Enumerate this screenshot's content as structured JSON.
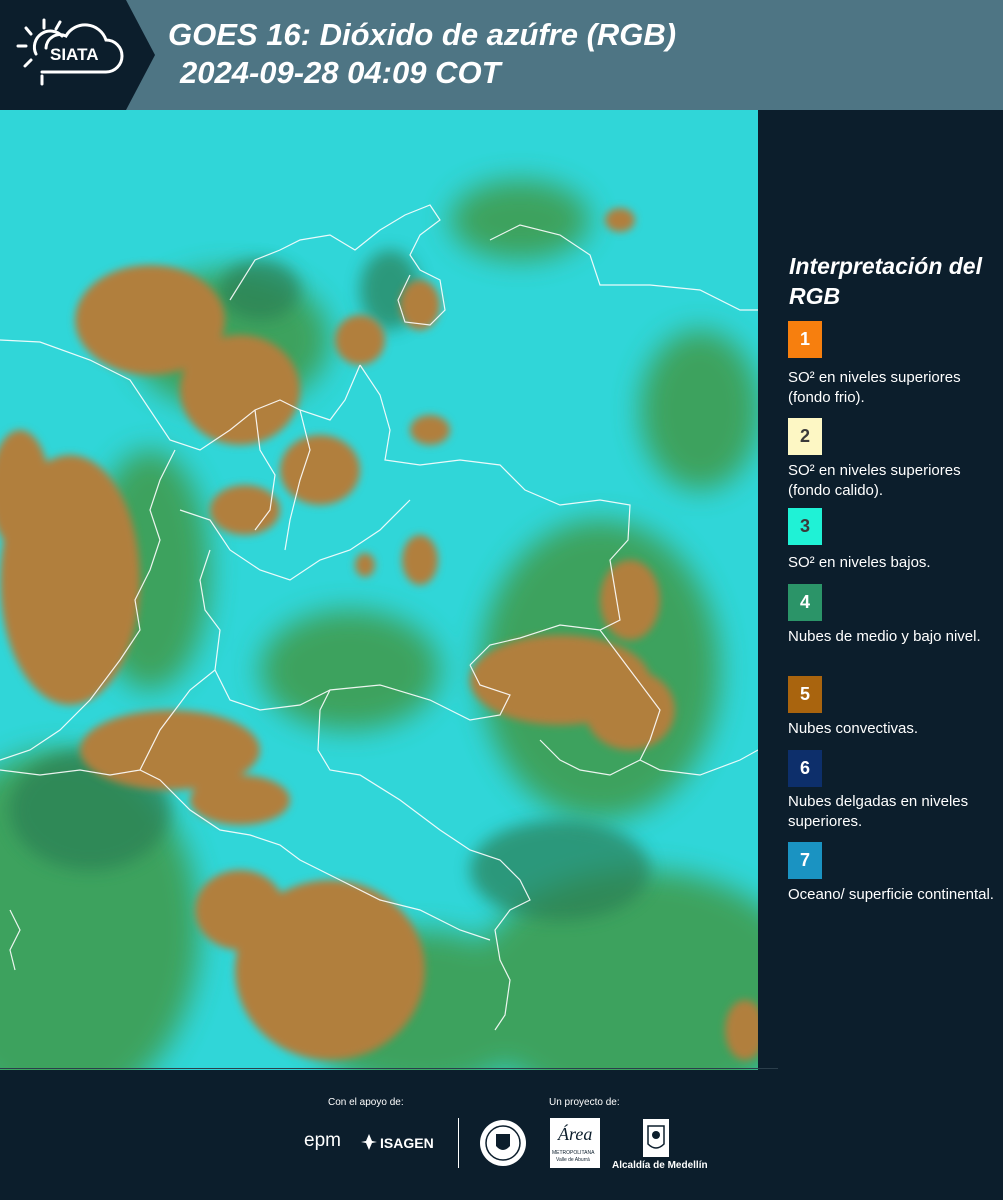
{
  "header": {
    "logo_text": "SIATA",
    "title_line1": "GOES 16: Dióxido de azúfre (RGB)",
    "title_line2": "2024-09-28 04:09 COT"
  },
  "map": {
    "background_color": "#2fd7d9"
  },
  "legend": {
    "title": "Interpretación del RGB",
    "items": [
      {
        "num": "1",
        "color": "#f77f0e",
        "text": "SO² en niveles superiores (fondo frio)."
      },
      {
        "num": "2",
        "color": "#fdf7c4",
        "text": "SO² en niveles superiores (fondo calido)."
      },
      {
        "num": "3",
        "color": "#1ff2d6",
        "text": "SO² en niveles bajos."
      },
      {
        "num": "4",
        "color": "#2b9468",
        "text": "Nubes de medio y bajo nivel."
      },
      {
        "num": "5",
        "color": "#a9640e",
        "text": "Nubes convectivas."
      },
      {
        "num": "6",
        "color": "#0d2f6b",
        "text": "Nubes delgadas en niveles superiores."
      },
      {
        "num": "7",
        "color": "#1a93c2",
        "text": "Oceano/ superficie continental."
      }
    ]
  },
  "footer": {
    "support_label": "Con el apoyo de:",
    "project_label": "Un proyecto de:",
    "epm": "epm",
    "isagen": "ISAGEN",
    "area_text": "Área",
    "area_sub1": "METROPOLITANA",
    "area_sub2": "Valle de Aburrá",
    "alcaldia": "Alcaldía de Medellín"
  }
}
